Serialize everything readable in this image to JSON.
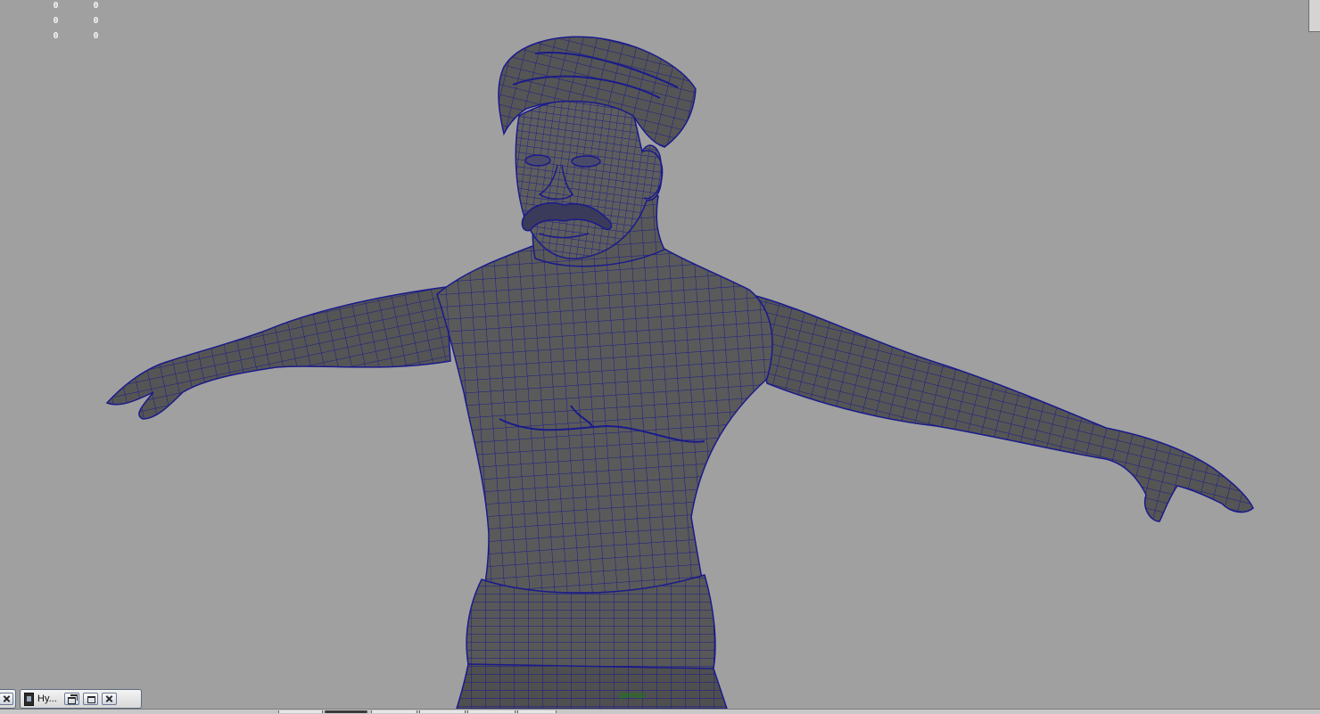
{
  "hud": {
    "rows": [
      [
        "0",
        "0"
      ],
      [
        "0",
        "0"
      ],
      [
        "0",
        "0"
      ]
    ]
  },
  "viewport": {
    "camera": "persp",
    "background_color": "#a0a0a0",
    "mesh_color": "#545454",
    "wire_color": "#1a1a8c"
  },
  "minimized_windows": [
    {
      "title": "Hy..."
    }
  ],
  "icons": {
    "close": "close-icon",
    "restore": "restore-icon",
    "maximize": "maximize-icon",
    "app": "maya-app-icon"
  }
}
